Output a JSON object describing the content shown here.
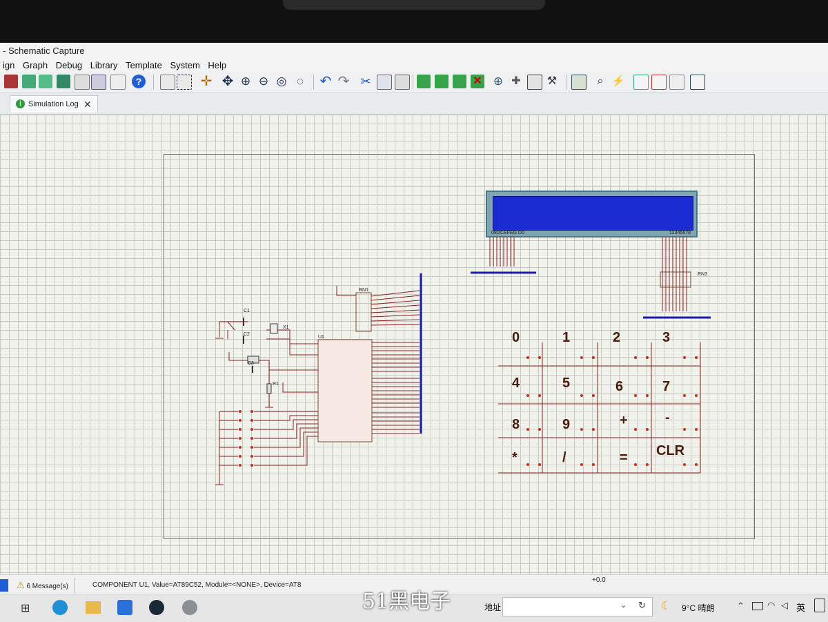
{
  "window": {
    "title": "- Schematic Capture"
  },
  "menu": {
    "items": [
      "ign",
      "Graph",
      "Debug",
      "Library",
      "Template",
      "System",
      "Help"
    ]
  },
  "tabs": [
    {
      "label": "Simulation Log",
      "close": "✕"
    }
  ],
  "schematic": {
    "lcd_pins_left": "08DCEFEG D0",
    "lcd_pins_right": "12345678",
    "rn1_label": "RN1",
    "rn3_label": "RN3",
    "mcu_label": "U1",
    "c1_label": "C1",
    "c2_label": "C2",
    "c3_label": "C3",
    "x1_label": "X1",
    "r1_label": "R1",
    "keypad_keys": [
      {
        "label": "0"
      },
      {
        "label": "1"
      },
      {
        "label": "2"
      },
      {
        "label": "3"
      },
      {
        "label": "4"
      },
      {
        "label": "5"
      },
      {
        "label": "6"
      },
      {
        "label": "7"
      },
      {
        "label": "8"
      },
      {
        "label": "9"
      },
      {
        "label": "+"
      },
      {
        "label": "-"
      },
      {
        "label": "*"
      },
      {
        "label": "/"
      },
      {
        "label": "="
      },
      {
        "label": "CLR"
      }
    ]
  },
  "status": {
    "messages": "6 Message(s)",
    "component": "COMPONENT U1, Value=AT89C52, Module=<NONE>, Device=AT8",
    "coord": "+0.0"
  },
  "taskbar": {
    "address_label": "地址",
    "weather": "9°C 晴朗",
    "ime": "英"
  },
  "watermark": "51黑电子",
  "colors": {
    "lcd": "#1a2bd1",
    "bus": "#1a1aa8",
    "wire": "#8a2020",
    "grid_bg": "#f1f2ec"
  }
}
